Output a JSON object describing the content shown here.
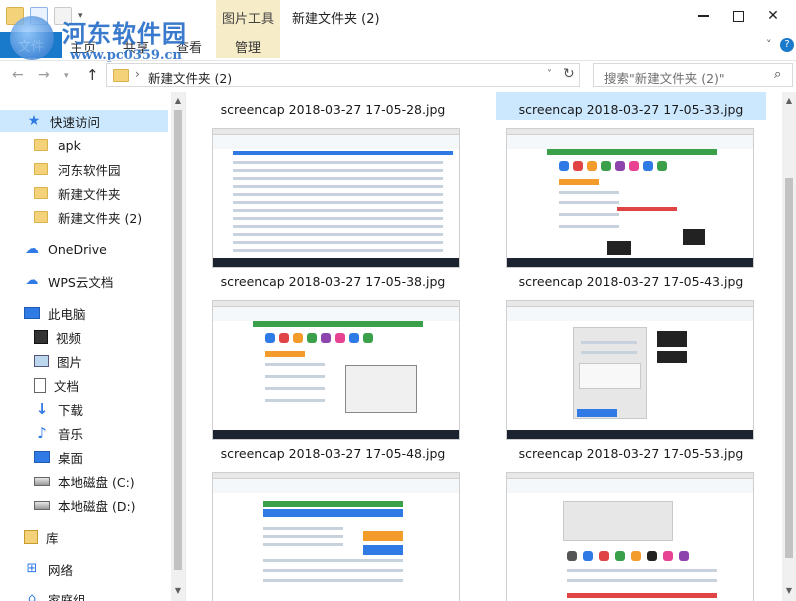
{
  "window": {
    "title": "新建文件夹 (2)",
    "ribbon_tool_group": "图片工具"
  },
  "watermark": {
    "text": "河东软件园",
    "url": "www.pc0359.cn"
  },
  "ribbon": {
    "tabs": [
      "文件",
      "主页",
      "共享",
      "查看",
      "管理"
    ]
  },
  "address": {
    "path": "新建文件夹 (2)",
    "search_placeholder": "搜索\"新建文件夹 (2)\""
  },
  "sidebar": {
    "quick_access": "快速访问",
    "quick_items": [
      "apk",
      "河东软件园",
      "新建文件夹",
      "新建文件夹 (2)"
    ],
    "onedrive": "OneDrive",
    "wps": "WPS云文档",
    "this_pc": "此电脑",
    "pc_items": [
      "视频",
      "图片",
      "文档",
      "下载",
      "音乐",
      "桌面",
      "本地磁盘 (C:)",
      "本地磁盘 (D:)"
    ],
    "library": "库",
    "network": "网络",
    "homegroup": "家庭组"
  },
  "files": [
    {
      "name": "screencap 2018-03-27 17-05-28.jpg",
      "selected": false
    },
    {
      "name": "screencap 2018-03-27 17-05-33.jpg",
      "selected": true
    },
    {
      "name": "screencap 2018-03-27 17-05-38.jpg",
      "selected": false
    },
    {
      "name": "screencap 2018-03-27 17-05-43.jpg",
      "selected": false
    },
    {
      "name": "screencap 2018-03-27 17-05-48.jpg",
      "selected": false
    },
    {
      "name": "screencap 2018-03-27 17-05-53.jpg",
      "selected": false
    }
  ],
  "colors": {
    "accent": "#1979ca",
    "selection": "#cce8ff",
    "ribbon_tool_bg": "#f7ecc8"
  }
}
